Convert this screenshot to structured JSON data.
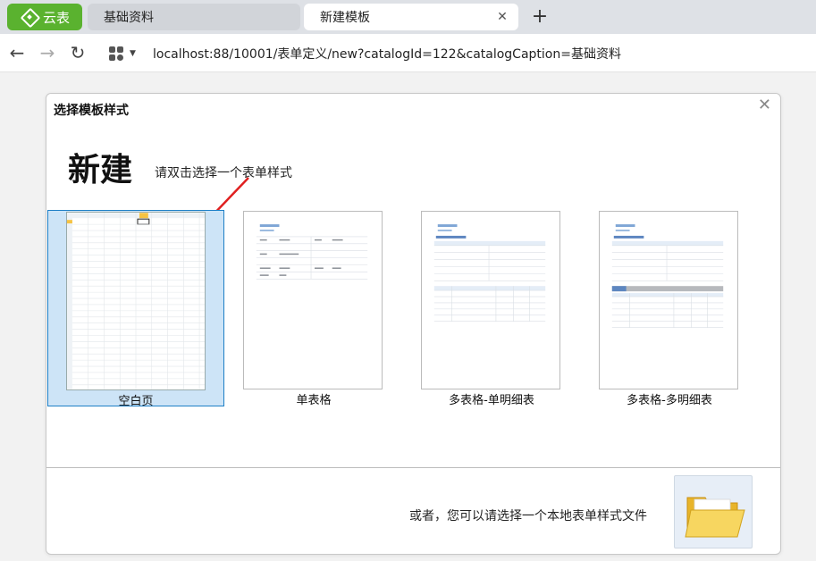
{
  "browser": {
    "app_button": "云表",
    "tabs": [
      {
        "label": "基础资料"
      },
      {
        "label": "新建模板"
      }
    ],
    "url": "localhost:88/10001/表单定义/new?catalogId=122&catalogCaption=基础资料"
  },
  "dialog": {
    "title": "选择模板样式",
    "heading": "新建",
    "hint": "请双击选择一个表单样式",
    "templates": [
      {
        "label": "空白页",
        "selected": true
      },
      {
        "label": "单表格",
        "selected": false
      },
      {
        "label": "多表格-单明细表",
        "selected": false
      },
      {
        "label": "多表格-多明细表",
        "selected": false
      }
    ],
    "footer_text": "或者，您可以请选择一个本地表单样式文件"
  },
  "colors": {
    "app_green": "#5ab22f",
    "selection_bg": "#cde4f7",
    "selection_border": "#1e7fc6",
    "arrow_red": "#e02020"
  }
}
